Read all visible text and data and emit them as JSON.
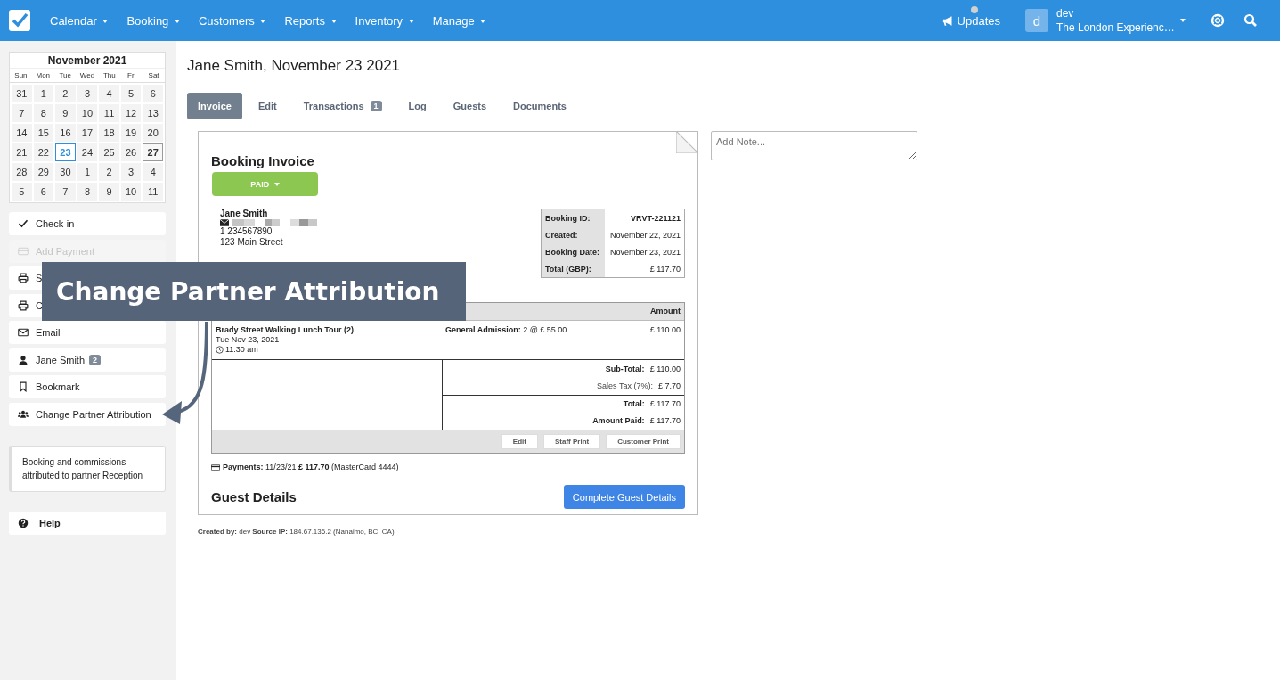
{
  "nav": {
    "menus": [
      "Calendar",
      "Booking",
      "Customers",
      "Reports",
      "Inventory",
      "Manage"
    ],
    "updates": "Updates",
    "avatar": "d",
    "user": "dev",
    "org": "The London Experienc…"
  },
  "calendar": {
    "title": "November 2021",
    "weekdays": [
      "Sun",
      "Mon",
      "Tue",
      "Wed",
      "Thu",
      "Fri",
      "Sat"
    ],
    "weeks": [
      [
        {
          "d": "31",
          "selected": false,
          "today": false
        },
        {
          "d": "1",
          "selected": false,
          "today": false
        },
        {
          "d": "2",
          "selected": false,
          "today": false
        },
        {
          "d": "3",
          "selected": false,
          "today": false
        },
        {
          "d": "4",
          "selected": false,
          "today": false
        },
        {
          "d": "5",
          "selected": false,
          "today": false
        },
        {
          "d": "6",
          "selected": false,
          "today": false
        }
      ],
      [
        {
          "d": "7",
          "selected": false,
          "today": false
        },
        {
          "d": "8",
          "selected": false,
          "today": false
        },
        {
          "d": "9",
          "selected": false,
          "today": false
        },
        {
          "d": "10",
          "selected": false,
          "today": false
        },
        {
          "d": "11",
          "selected": false,
          "today": false
        },
        {
          "d": "12",
          "selected": false,
          "today": false
        },
        {
          "d": "13",
          "selected": false,
          "today": false
        }
      ],
      [
        {
          "d": "14",
          "selected": false,
          "today": false
        },
        {
          "d": "15",
          "selected": false,
          "today": false
        },
        {
          "d": "16",
          "selected": false,
          "today": false
        },
        {
          "d": "17",
          "selected": false,
          "today": false
        },
        {
          "d": "18",
          "selected": false,
          "today": false
        },
        {
          "d": "19",
          "selected": false,
          "today": false
        },
        {
          "d": "20",
          "selected": false,
          "today": false
        }
      ],
      [
        {
          "d": "21",
          "selected": false,
          "today": false
        },
        {
          "d": "22",
          "selected": false,
          "today": false
        },
        {
          "d": "23",
          "selected": true,
          "today": false
        },
        {
          "d": "24",
          "selected": false,
          "today": false
        },
        {
          "d": "25",
          "selected": false,
          "today": false
        },
        {
          "d": "26",
          "selected": false,
          "today": false
        },
        {
          "d": "27",
          "selected": false,
          "today": true
        }
      ],
      [
        {
          "d": "28",
          "selected": false,
          "today": false
        },
        {
          "d": "29",
          "selected": false,
          "today": false
        },
        {
          "d": "30",
          "selected": false,
          "today": false
        },
        {
          "d": "1",
          "selected": false,
          "today": false
        },
        {
          "d": "2",
          "selected": false,
          "today": false
        },
        {
          "d": "3",
          "selected": false,
          "today": false
        },
        {
          "d": "4",
          "selected": false,
          "today": false
        }
      ],
      [
        {
          "d": "5",
          "selected": false,
          "today": false
        },
        {
          "d": "6",
          "selected": false,
          "today": false
        },
        {
          "d": "7",
          "selected": false,
          "today": false
        },
        {
          "d": "8",
          "selected": false,
          "today": false
        },
        {
          "d": "9",
          "selected": false,
          "today": false
        },
        {
          "d": "10",
          "selected": false,
          "today": false
        },
        {
          "d": "11",
          "selected": false,
          "today": false
        }
      ]
    ]
  },
  "actions": [
    {
      "kind": "check",
      "label": "Check-in",
      "disabled": false
    },
    {
      "kind": "card",
      "label": "Add Payment",
      "disabled": true
    },
    {
      "kind": "print",
      "label": "S",
      "disabled": false
    },
    {
      "kind": "print",
      "label": "C",
      "disabled": false
    },
    {
      "kind": "email",
      "label": "Email",
      "disabled": false
    },
    {
      "kind": "person",
      "label": "Jane Smith",
      "badge": "2",
      "disabled": false
    },
    {
      "kind": "bookmark",
      "label": "Bookmark",
      "disabled": false
    },
    {
      "kind": "people",
      "label": "Change Partner Attribution",
      "disabled": false
    }
  ],
  "partner_note": "Booking and commissions attributed to partner Reception",
  "help": "Help",
  "title": "Jane Smith, November 23 2021",
  "tabs": [
    {
      "label": "Invoice",
      "selected": true
    },
    {
      "label": "Edit",
      "selected": false
    },
    {
      "label": "Transactions",
      "badge": "1",
      "selected": false
    },
    {
      "label": "Log",
      "selected": false
    },
    {
      "label": "Guests",
      "selected": false
    },
    {
      "label": "Documents",
      "selected": false
    }
  ],
  "note": {
    "placeholder": "Add Note..."
  },
  "invoice": {
    "heading": "Booking Invoice",
    "status": "PAID",
    "customer": {
      "name": "Jane Smith",
      "phone": "1 234567890",
      "street": "123 Main Street"
    },
    "info": [
      {
        "label": "Booking ID:",
        "value": "VRVT-221121"
      },
      {
        "label": "Created:",
        "value": "November 22, 2021"
      },
      {
        "label": "Booking Date:",
        "value": "November 23, 2021"
      },
      {
        "label": "Total (GBP):",
        "value": "£ 117.70"
      }
    ],
    "amount_header": "Amount",
    "items": [
      {
        "product": "Brady Street Walking Lunch Tour (2)",
        "date": "Tue Nov 23, 2021",
        "time": "11:30 am",
        "rate": "**General Admission:** 2 @ £ 55.00",
        "amount": "£ 110.00"
      }
    ],
    "totals": [
      [
        {
          "label": "Sub-Total:",
          "value": "£ 110.00",
          "bold": true
        },
        {
          "label": "Sales Tax (7%):",
          "value": "£ 7.70",
          "bold": false
        }
      ],
      [
        {
          "label": "Total:",
          "value": "£ 117.70",
          "bold": true
        },
        {
          "label": "Amount Paid:",
          "value": "£ 117.70",
          "bold": true
        }
      ]
    ],
    "buttons": [
      "Edit",
      "Staff Print",
      "Customer Print"
    ],
    "payments": "**Payments:** 11/23/21 **£ 117.70** (MasterCard 4444)",
    "guest_heading": "Guest Details",
    "guest_button": "Complete Guest Details"
  },
  "created": "**Created by:** dev **Source IP:** 184.67.136.2 (Nanaimo, BC, CA)",
  "callout": "Change Partner Attribution"
}
